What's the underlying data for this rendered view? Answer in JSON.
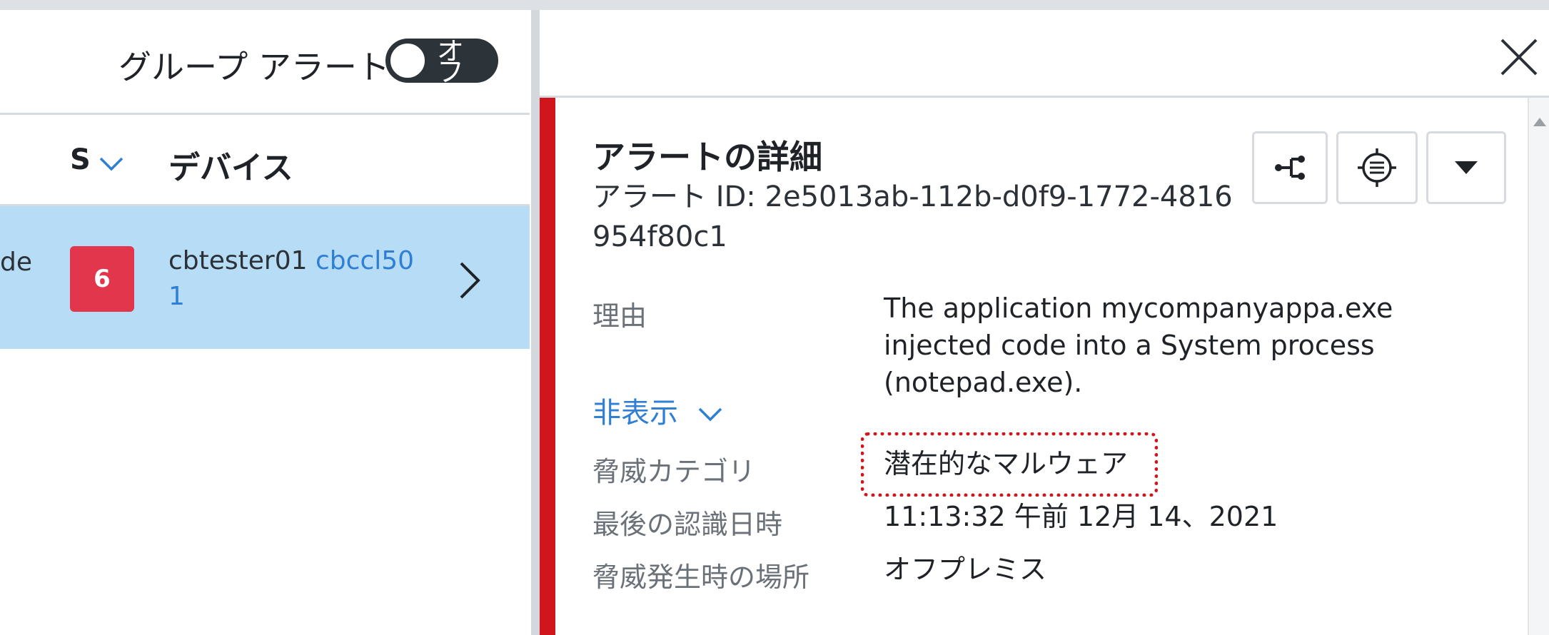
{
  "left_panel": {
    "group_alerts_label": "グループ アラート",
    "group_toggle_text": "オフ",
    "columns": {
      "s_label": "S",
      "device_label": "デバイス"
    },
    "row": {
      "fragment_text": "de",
      "severity": "6",
      "device_user": "cbtester01",
      "device_name": "cbccl501"
    }
  },
  "detail": {
    "title": "アラートの詳細",
    "alert_id_label": "アラート ID:",
    "alert_id": "2e5013ab-112b-d0f9-1772-4816954f80c1",
    "reason_label": "理由",
    "reason_value": "The application mycompanyappa.exe injected code into a System process (notepad.exe).",
    "hide_link": "非表示",
    "threat_category_label": "脅威カテゴリ",
    "threat_category_value": "潜在的なマルウェア",
    "last_seen_label": "最後の認識日時",
    "last_seen_value": "11:13:32 午前 12月 14、2021",
    "location_label": "脅威発生時の場所",
    "location_value": "オフプレミス"
  },
  "colors": {
    "severity_strip": "#d0161c",
    "severity_badge": "#e1364b",
    "selected_row": "#b7dcf6",
    "link": "#2f7fd4",
    "highlight_border": "#d0161c"
  },
  "icons": {
    "sort": "caret-down-icon",
    "row_open": "chevron-right-icon",
    "close": "close-icon",
    "process_tree": "process-tree-icon",
    "investigate": "investigate-icon",
    "more": "dropdown-caret-icon",
    "expand": "chevron-down-icon"
  }
}
